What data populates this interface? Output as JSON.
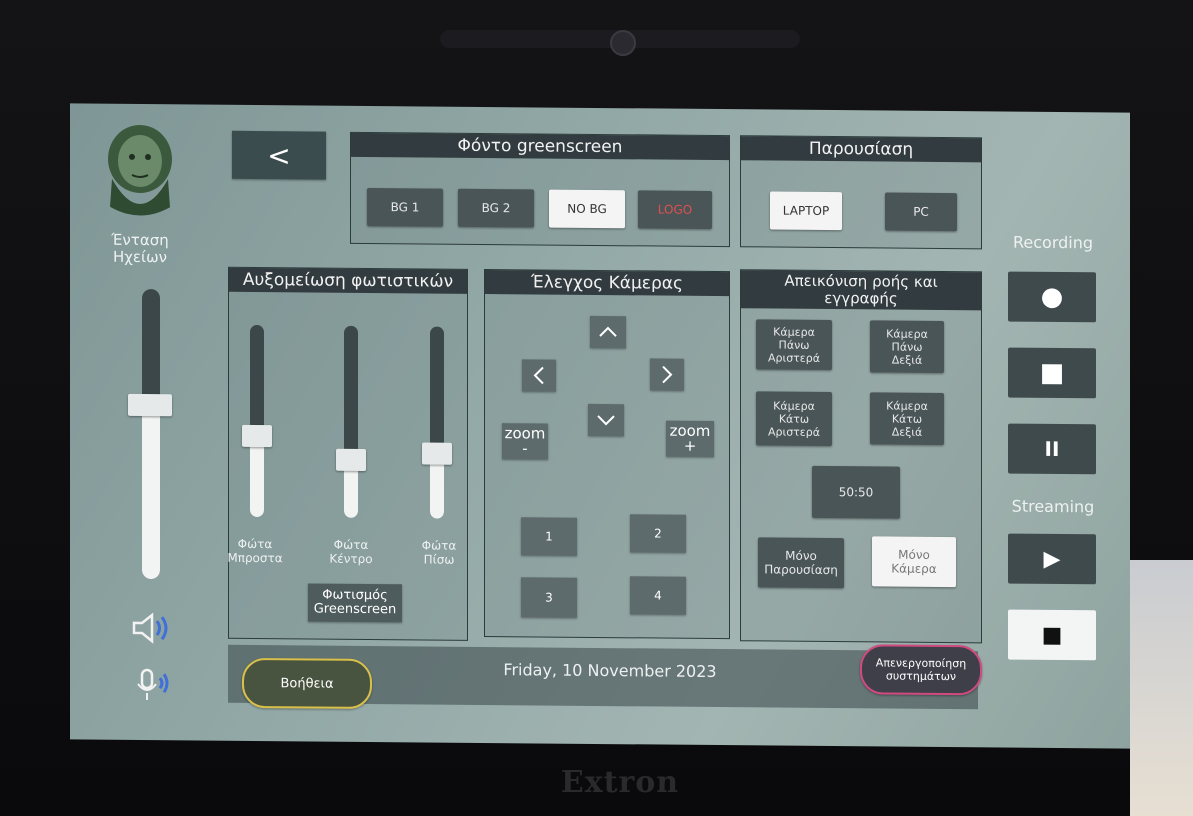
{
  "brand": "Extron",
  "volume": {
    "label_line1": "Ένταση",
    "label_line2": "Ηχείων",
    "level": 0.6
  },
  "back_button": {
    "label": "<"
  },
  "greenscreen": {
    "title": "Φόντο greenscreen",
    "buttons": [
      "BG 1",
      "BG 2",
      "NO BG",
      "LOGO"
    ],
    "active": "NO BG"
  },
  "presentation": {
    "title": "Παρουσίαση",
    "buttons": [
      "LAPTOP",
      "PC"
    ],
    "active": "LAPTOP"
  },
  "lights": {
    "title": "Αυξομείωση φωτιστικών",
    "sliders": [
      {
        "line1": "Φώτα",
        "line2": "Μπροστα",
        "level": 0.42
      },
      {
        "line1": "Φώτα",
        "line2": "Κέντρο",
        "level": 0.3
      },
      {
        "line1": "Φώτα",
        "line2": "Πίσω",
        "level": 0.34
      }
    ],
    "greenscreen_button_line1": "Φωτισμός",
    "greenscreen_button_line2": "Greenscreen"
  },
  "camera": {
    "title": "Έλεγχος Κάμερας",
    "up": "^",
    "left": "<",
    "right": ">",
    "down": "v",
    "zoom_minus_line1": "zoom",
    "zoom_minus_line2": "-",
    "zoom_plus_line1": "zoom",
    "zoom_plus_line2": "+",
    "presets": [
      "1",
      "2",
      "3",
      "4"
    ]
  },
  "display": {
    "title_line1": "Απεικόνιση ροής και",
    "title_line2": "εγγραφής",
    "cams": [
      {
        "l1": "Κάμερα",
        "l2": "Πάνω",
        "l3": "Αριστερά"
      },
      {
        "l1": "Κάμερα",
        "l2": "Πάνω",
        "l3": "Δεξιά"
      },
      {
        "l1": "Κάμερα",
        "l2": "Κάτω",
        "l3": "Αριστερά"
      },
      {
        "l1": "Κάμερα",
        "l2": "Κάτω",
        "l3": "Δεξιά"
      }
    ],
    "split": "50:50",
    "only_presentation_line1": "Μόνο",
    "only_presentation_line2": "Παρουσίαση",
    "only_camera_line1": "Μόνο",
    "only_camera_line2": "Κάμερα",
    "active": "only_camera"
  },
  "recording": {
    "label": "Recording",
    "record": "●",
    "stop": "■",
    "pause": "II"
  },
  "streaming": {
    "label": "Streaming",
    "play": "▶",
    "stop": "■"
  },
  "footer": {
    "help": "Βοήθεια",
    "date": "Friday, 10 November 2023",
    "shutdown_line1": "Απενεργοποίηση",
    "shutdown_line2": "συστημάτων"
  },
  "icons": {
    "speaker": "speaker-icon",
    "microphone": "microphone-icon",
    "logo": "philosopher-logo"
  },
  "colors": {
    "panel_title_bg": "#323b3f",
    "button_bg": "#4a5558",
    "active_bg": "#f4f4f4",
    "help_border": "#d8c04a",
    "shutdown_border": "#d04a80",
    "logo_red": "#e05050"
  }
}
